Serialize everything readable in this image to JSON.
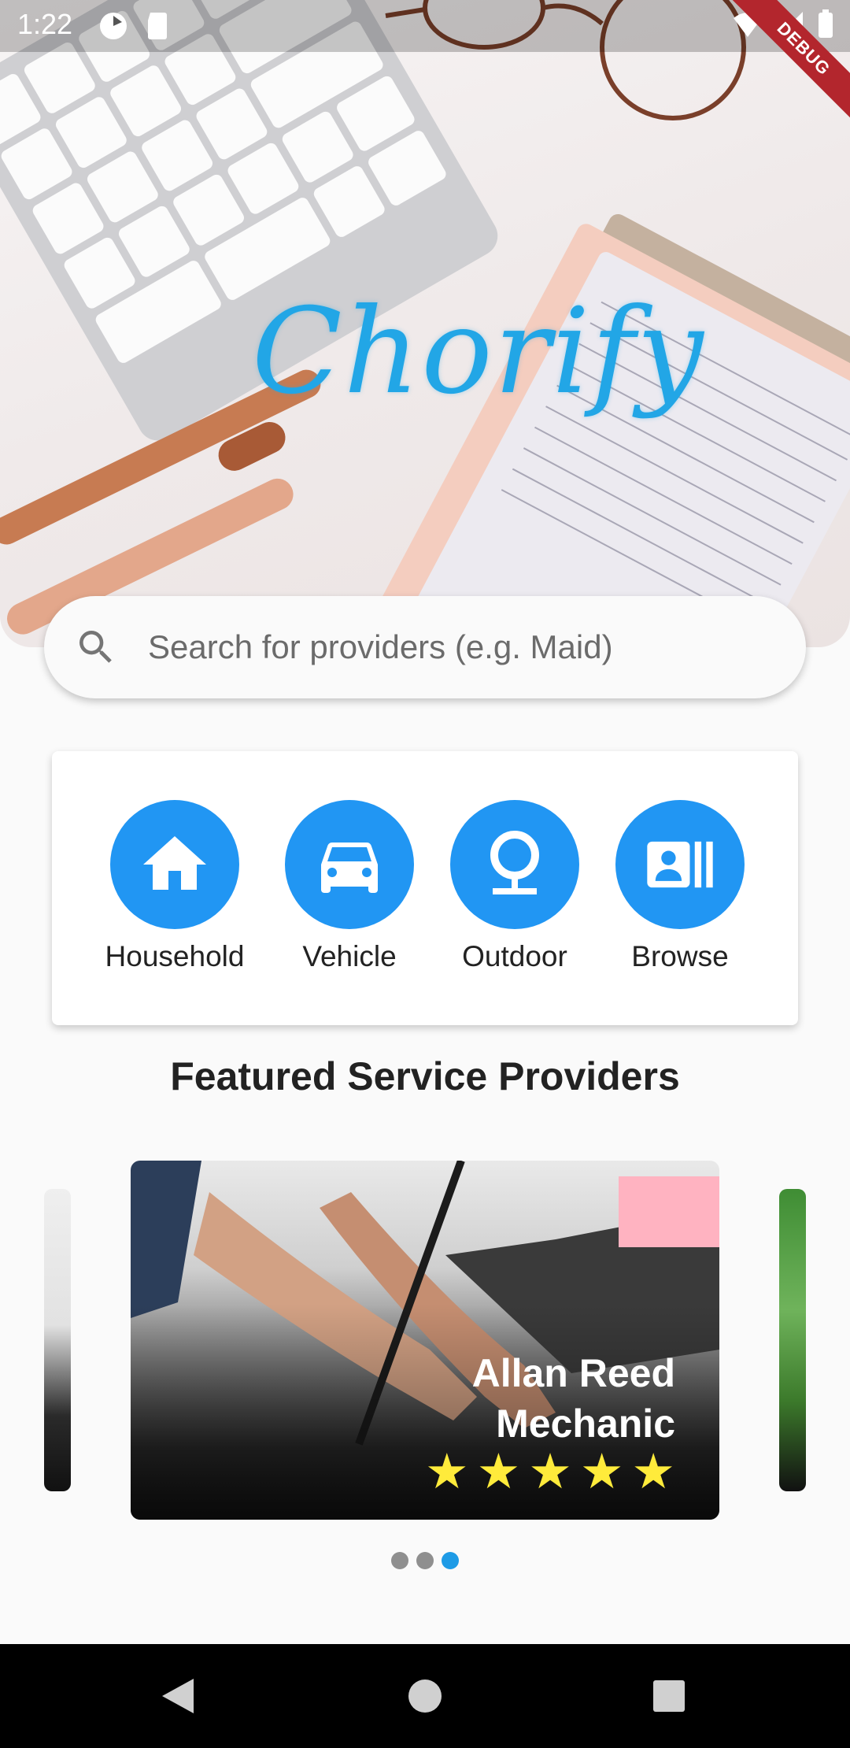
{
  "status_bar": {
    "time": "1:22",
    "debug_label": "DEBUG"
  },
  "hero": {
    "logo_text": "Chorify"
  },
  "search": {
    "placeholder": "Search for providers (e.g. Maid)"
  },
  "categories": [
    {
      "label": "Household",
      "icon": "home-icon"
    },
    {
      "label": "Vehicle",
      "icon": "car-icon"
    },
    {
      "label": "Outdoor",
      "icon": "tree-icon"
    },
    {
      "label": "Browse",
      "icon": "browse-icon"
    }
  ],
  "featured": {
    "title": "Featured Service Providers",
    "cards": [
      {
        "name": "Allan Reed",
        "role": "Mechanic",
        "rating": 5
      }
    ],
    "page_count": 3,
    "active_page": 3
  },
  "colors": {
    "accent": "#2196f3",
    "logo": "#22a6e6",
    "star": "#ffeb3b",
    "dot_active": "#1e9be6"
  },
  "nav": [
    "back",
    "home",
    "recents"
  ]
}
